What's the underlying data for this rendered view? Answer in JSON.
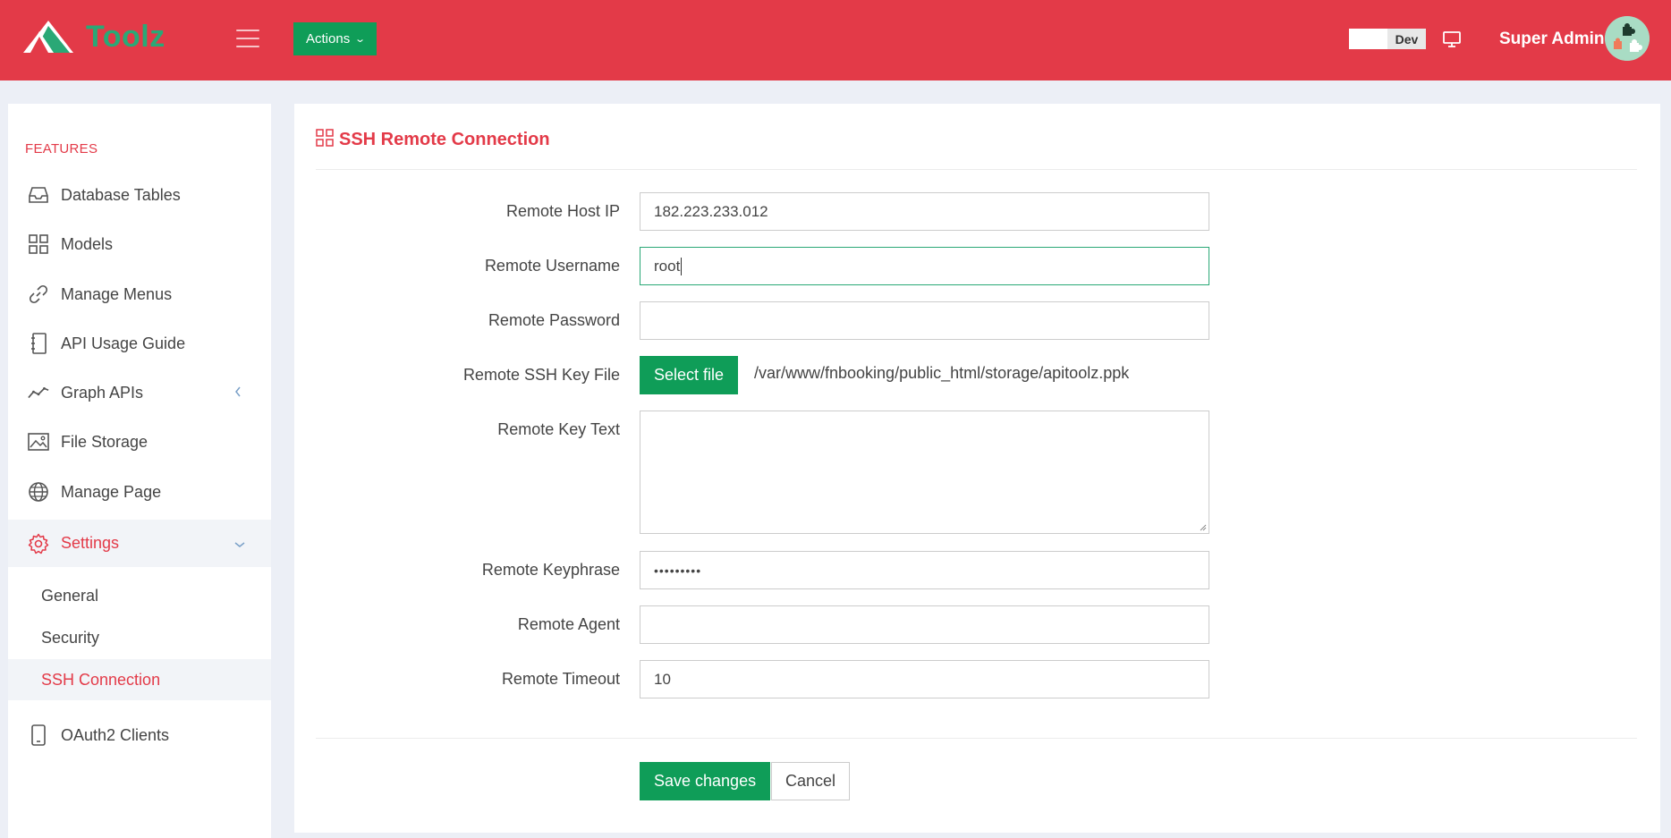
{
  "app": {
    "name": "Toolz",
    "brand_color": "#e33a48",
    "accent_color": "#0f9d58"
  },
  "header": {
    "actions_label": "Actions",
    "env_label": "Dev",
    "user_name": "Super Admin"
  },
  "sidebar": {
    "section_label": "FEATURES",
    "items": [
      {
        "label": "Database Tables",
        "icon": "inbox-icon"
      },
      {
        "label": "Models",
        "icon": "grid-icon"
      },
      {
        "label": "Manage Menus",
        "icon": "link-icon"
      },
      {
        "label": "API Usage Guide",
        "icon": "notebook-icon"
      },
      {
        "label": "Graph APIs",
        "icon": "trend-icon"
      },
      {
        "label": "File Storage",
        "icon": "image-icon"
      },
      {
        "label": "Manage Page",
        "icon": "globe-icon"
      },
      {
        "label": "Settings",
        "icon": "gear-icon"
      },
      {
        "label": "OAuth2 Clients",
        "icon": "tablet-icon"
      }
    ],
    "settings_sub": [
      {
        "label": "General"
      },
      {
        "label": "Security"
      },
      {
        "label": "SSH Connection"
      }
    ]
  },
  "form": {
    "title": "SSH Remote Connection",
    "fields": {
      "host_ip": {
        "label": "Remote Host IP",
        "value": "182.223.233.012"
      },
      "username": {
        "label": "Remote Username",
        "value": "root"
      },
      "password": {
        "label": "Remote Password",
        "value": ""
      },
      "ssh_key_file": {
        "label": "Remote SSH Key File",
        "button": "Select file",
        "path": "/var/www/fnbooking/public_html/storage/apitoolz.ppk"
      },
      "key_text": {
        "label": "Remote Key Text",
        "value": ""
      },
      "keyphrase": {
        "label": "Remote Keyphrase",
        "value": "•••••••••"
      },
      "agent": {
        "label": "Remote Agent",
        "value": ""
      },
      "timeout": {
        "label": "Remote Timeout",
        "value": "10"
      }
    },
    "save_label": "Save changes",
    "cancel_label": "Cancel"
  }
}
